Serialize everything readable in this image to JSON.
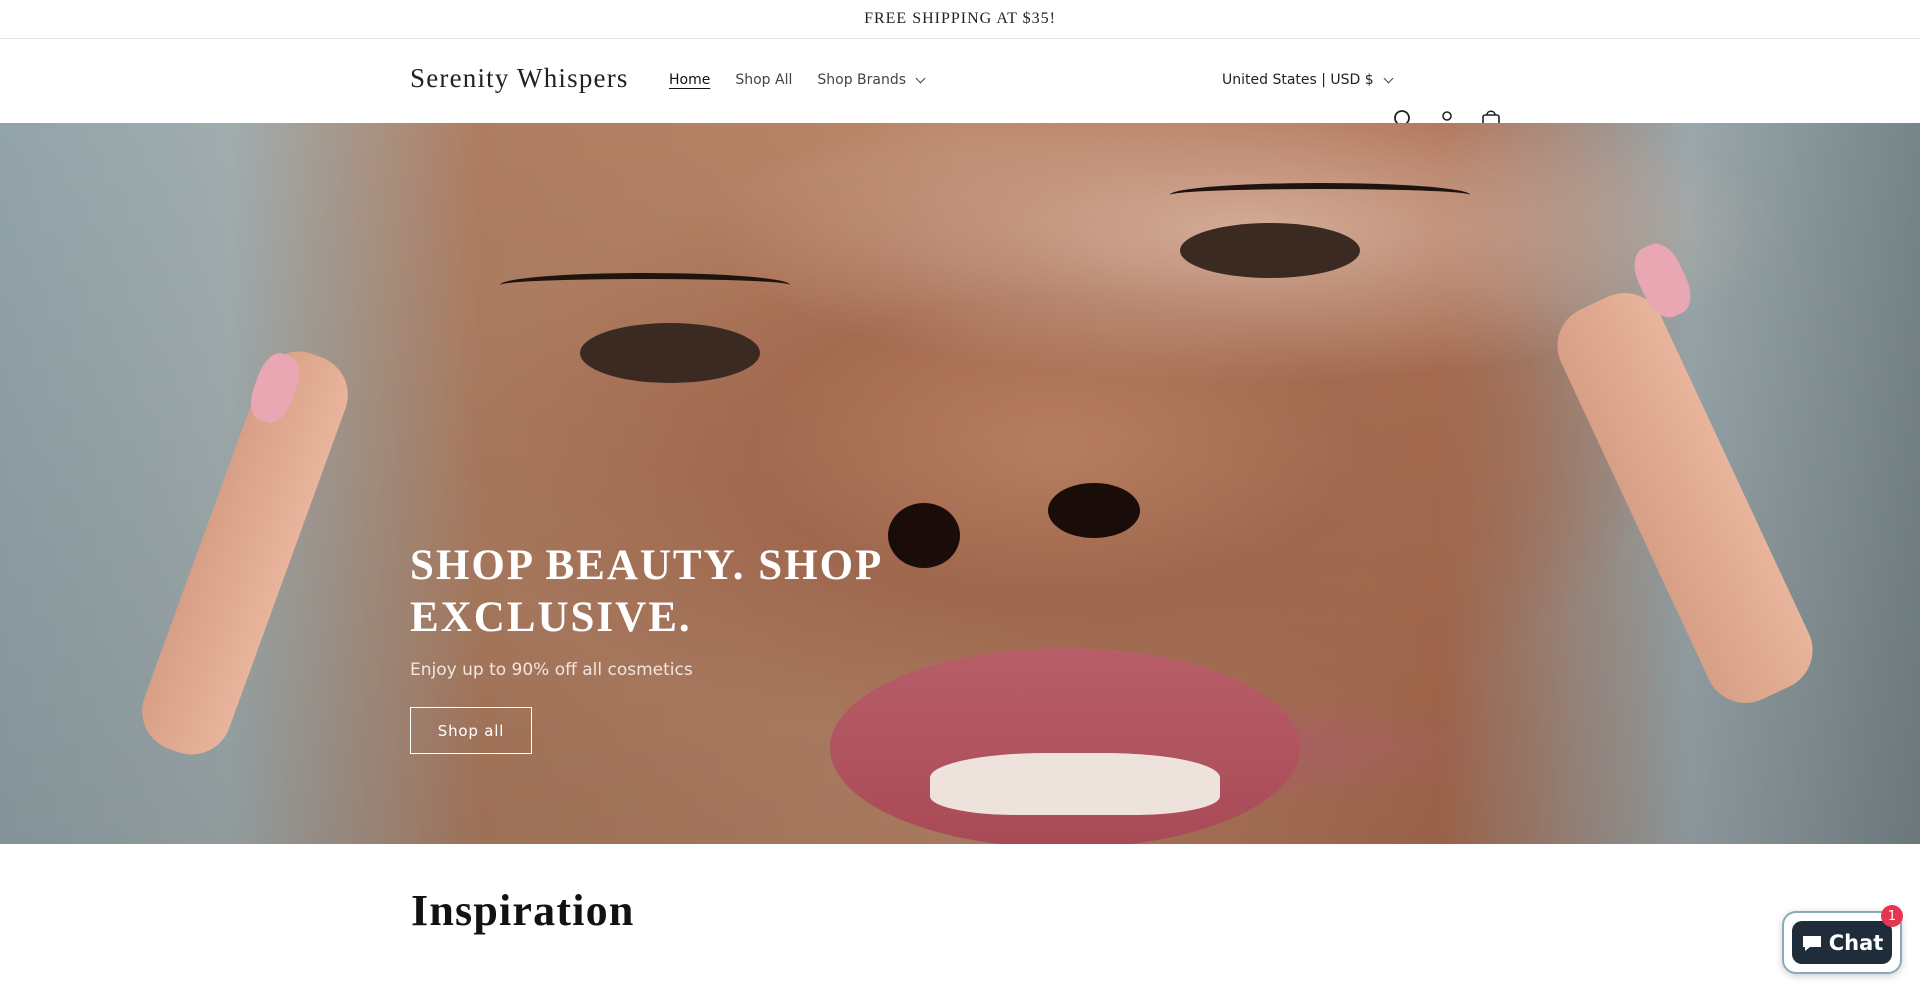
{
  "announcement": {
    "text": "FREE SHIPPING AT $35!"
  },
  "header": {
    "logo": "Serenity Whispers",
    "nav": [
      {
        "label": "Home",
        "active": true
      },
      {
        "label": "Shop All",
        "active": false
      },
      {
        "label": "Shop Brands",
        "active": false
      }
    ],
    "country": "United States | USD $",
    "icons": [
      "search-icon",
      "account-icon",
      "cart-icon"
    ]
  },
  "hero": {
    "title": "SHOP BEAUTY. SHOP EXCLUSIVE.",
    "subtitle": "Enjoy up to 90% off all cosmetics",
    "button": "Shop all"
  },
  "section": {
    "title": "Inspiration"
  },
  "chat": {
    "label": "Chat",
    "badge": "1"
  },
  "colors": {
    "accent": "#121212",
    "chat_bg": "#1f2d3a",
    "badge": "#e5354f"
  }
}
